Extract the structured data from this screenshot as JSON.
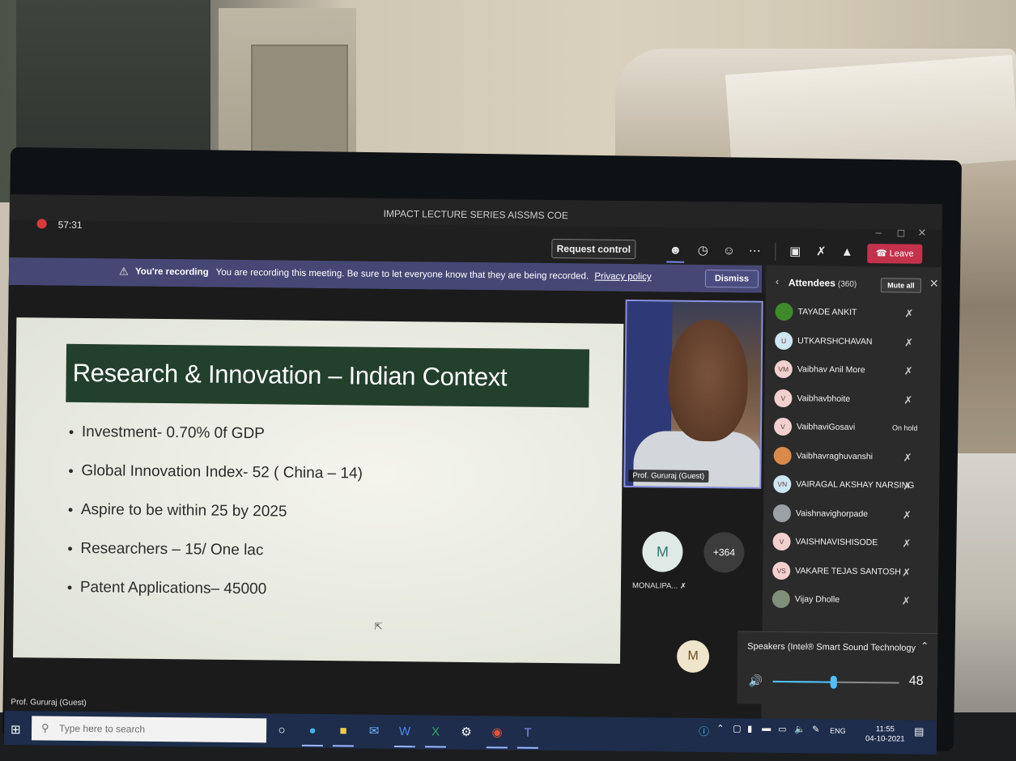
{
  "window": {
    "title": "IMPACT LECTURE SERIES AISSMS COE",
    "timer": "57:31",
    "controls": {
      "minimize": "–",
      "maximize": "◻",
      "close": "✕"
    }
  },
  "toolbar": {
    "request_control": "Request control",
    "leave": "Leave",
    "icons": [
      "people-icon",
      "chat-icon",
      "reactions-icon",
      "more-icon",
      "camera-off-icon",
      "mic-off-icon",
      "share-icon",
      "phone-icon"
    ]
  },
  "banner": {
    "title": "You're recording",
    "message": "You are recording this meeting. Be sure to let everyone know that they are being recorded.",
    "link": "Privacy policy",
    "dismiss": "Dismiss"
  },
  "slide": {
    "title": "Research & Innovation – Indian Context",
    "bullets": [
      "Investment- 0.70% 0f GDP",
      "Global Innovation Index- 52 ( China – 14)",
      "Aspire to be within 25 by 2025",
      "Researchers – 15/ One lac",
      "Patent Applications– 45000"
    ]
  },
  "video": {
    "label": "Prof. Gururaj (Guest)"
  },
  "participants": {
    "m_initial": "M",
    "more_count": "+364",
    "m_name": "MONALIPA...",
    "m2_initial": "M"
  },
  "attendees": {
    "title": "Attendees",
    "count": "(360)",
    "mute_all": "Mute all",
    "list": [
      {
        "initials": "",
        "name": "TAYADE ANKIT",
        "status": "muted",
        "avatar_color": "#3e8a2a"
      },
      {
        "initials": "U",
        "name": "UTKARSHCHAVAN",
        "status": "muted",
        "avatar_color": "#cfe6f2"
      },
      {
        "initials": "VM",
        "name": "Vaibhav Anil More",
        "status": "muted",
        "avatar_color": "#f3d0d0"
      },
      {
        "initials": "V",
        "name": "Vaibhavbhoite",
        "status": "muted",
        "avatar_color": "#f3d0d0"
      },
      {
        "initials": "V",
        "name": "VaibhaviGosavi",
        "status": "On hold",
        "avatar_color": "#f3d0d0"
      },
      {
        "initials": "",
        "name": "Vaibhavraghuvanshi",
        "status": "muted",
        "avatar_color": "#d98a4a"
      },
      {
        "initials": "VN",
        "name": "VAIRAGAL AKSHAY NARSING",
        "status": "muted",
        "avatar_color": "#cfe6f2"
      },
      {
        "initials": "",
        "name": "Vaishnavighorpade",
        "status": "muted",
        "avatar_color": "#9aa0a6"
      },
      {
        "initials": "V",
        "name": "VAISHNAVISHISODE",
        "status": "muted",
        "avatar_color": "#f3d0d0"
      },
      {
        "initials": "VS",
        "name": "VAKARE TEJAS SANTOSH",
        "status": "muted",
        "avatar_color": "#f3d0d0"
      },
      {
        "initials": "",
        "name": "Vijay Dholle",
        "status": "muted",
        "avatar_color": "#7f8f7a"
      }
    ]
  },
  "audio": {
    "device": "Speakers (Intel® Smart Sound Technology fo...",
    "volume": "48",
    "volume_fraction": 0.48
  },
  "presenter": {
    "name": "Prof. Gururaj (Guest)"
  },
  "taskbar": {
    "search_placeholder": "Type here to search",
    "apps": [
      "task-view-icon",
      "edge-icon",
      "file-explorer-icon",
      "mail-icon",
      "word-icon",
      "excel-icon",
      "settings-icon",
      "chrome-icon",
      "teams-icon"
    ],
    "language": "ENG",
    "time": "11:55",
    "date": "04-10-2021"
  }
}
